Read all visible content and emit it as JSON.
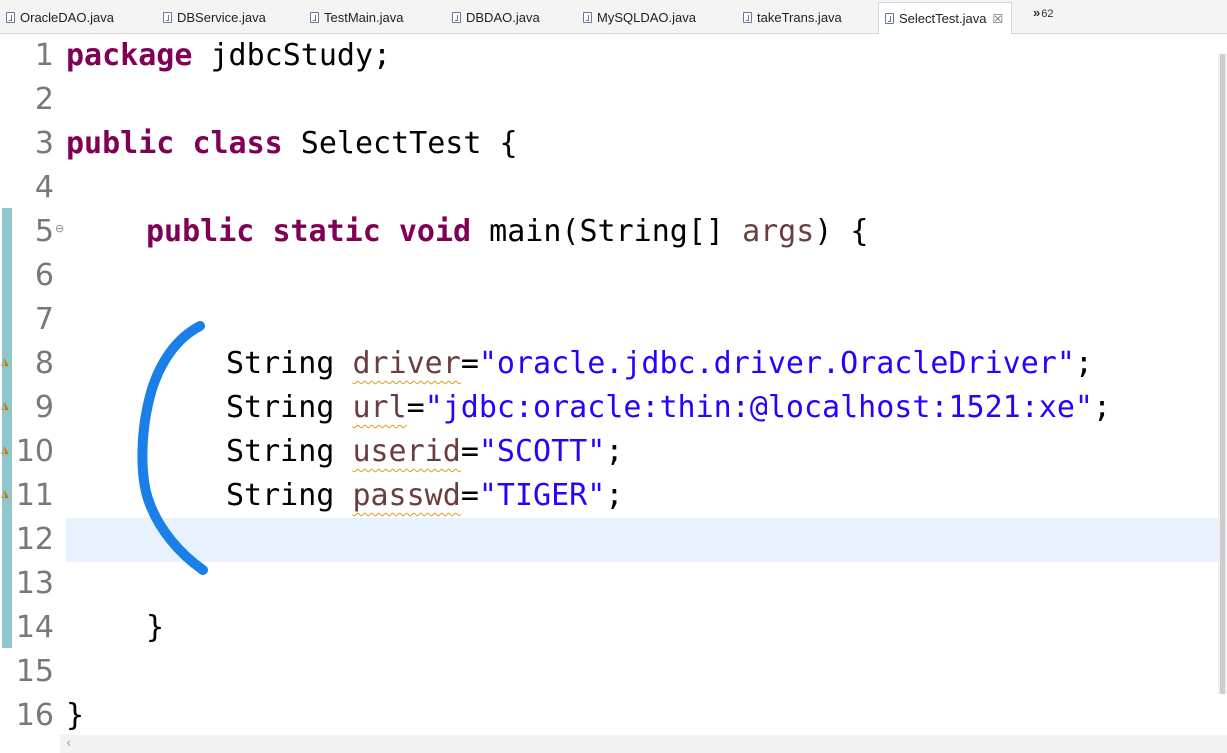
{
  "tabs": [
    {
      "label": "OracleDAO.java"
    },
    {
      "label": "DBService.java"
    },
    {
      "label": "TestMain.java"
    },
    {
      "label": "DBDAO.java"
    },
    {
      "label": "MySQLDAO.java"
    },
    {
      "label": "takeTrans.java"
    },
    {
      "label": "SelectTest.java",
      "active": true,
      "close": "☒"
    }
  ],
  "overflow": {
    "chevron": "»",
    "count": "62"
  },
  "line_numbers": [
    "1",
    "2",
    "3",
    "4",
    "5",
    "6",
    "7",
    "8",
    "9",
    "10",
    "11",
    "12",
    "13",
    "14",
    "15",
    "16"
  ],
  "code": {
    "l1": {
      "kw": "package",
      "rest": " jdbcStudy;"
    },
    "l3": {
      "kw1": "public",
      "kw2": "class",
      "rest": " SelectTest {"
    },
    "l5": {
      "kw1": "public",
      "kw2": "static",
      "kw3": "void",
      "pre": " main(String[] ",
      "var": "args",
      "post": ") {"
    },
    "l8": {
      "type": "String ",
      "var": "driver",
      "eq": "=",
      "str": "\"oracle.jdbc.driver.OracleDriver\"",
      "end": ";"
    },
    "l9": {
      "type": "String ",
      "var": "url",
      "eq": "=",
      "str": "\"jdbc:oracle:thin:@localhost:1521:xe\"",
      "end": ";"
    },
    "l10": {
      "type": "String ",
      "var": "userid",
      "eq": "=",
      "str": "\"SCOTT\"",
      "end": ";"
    },
    "l11": {
      "type": "String ",
      "var": "passwd",
      "eq": "=",
      "str": "\"TIGER\"",
      "end": ";"
    },
    "l14": {
      "text": "}"
    },
    "l16": {
      "text": "}"
    }
  },
  "colors": {
    "keyword": "#7f0055",
    "string": "#2a00ff",
    "variable": "#6a3e3e",
    "current_line": "#e8f2fe",
    "annotation": "#1a7fe8"
  },
  "icons": {
    "file": "java-file-icon",
    "warning": "warning-icon",
    "fold": "collapse-icon"
  }
}
